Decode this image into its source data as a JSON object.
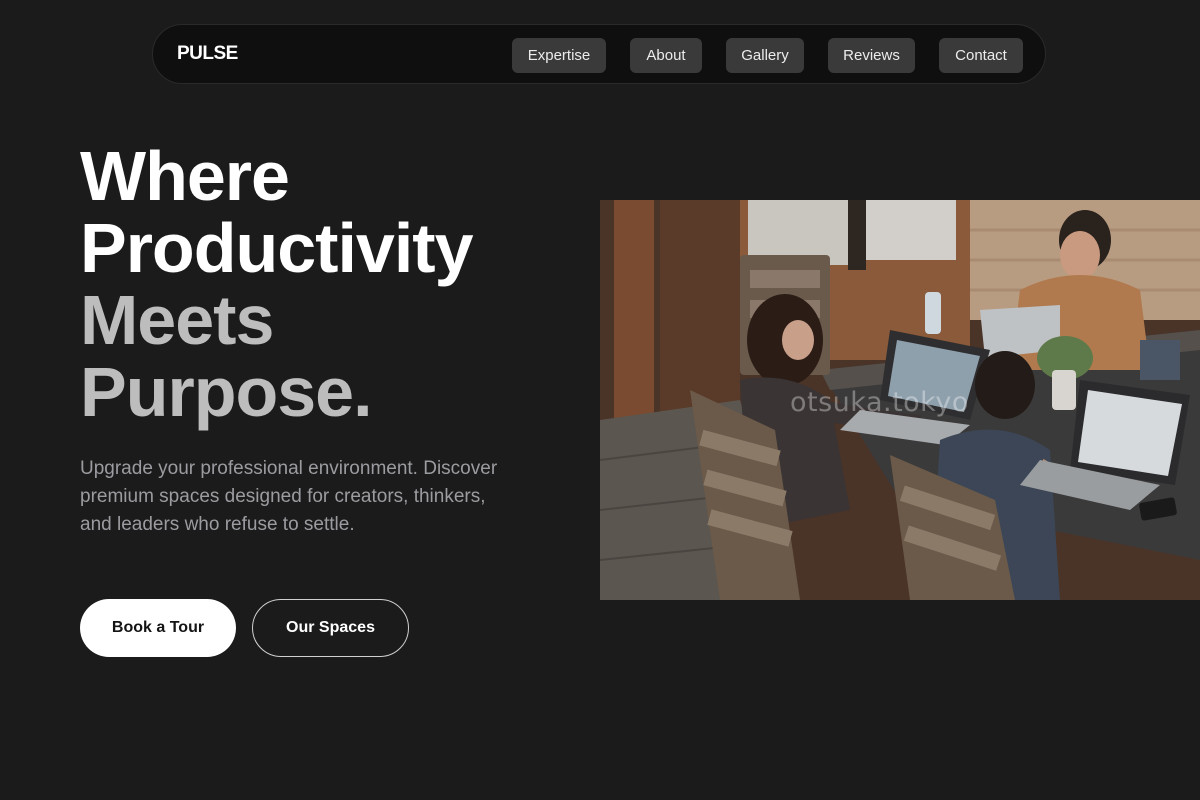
{
  "brand": "PULSE",
  "nav": {
    "items": [
      {
        "label": "Expertise"
      },
      {
        "label": "About"
      },
      {
        "label": "Gallery"
      },
      {
        "label": "Reviews"
      },
      {
        "label": "Contact"
      }
    ]
  },
  "hero": {
    "headline_lines": [
      "Where",
      "Productivity",
      "Meets",
      "Purpose."
    ],
    "subtitle": "Upgrade your professional environment. Discover premium spaces designed for creators, thinkers, and leaders who refuse to settle.",
    "primary_cta": "Book a Tour",
    "secondary_cta": "Our Spaces"
  },
  "photo": {
    "watermark": "otsuka.tokyo"
  },
  "colors": {
    "background": "#1b1b1c",
    "nav_background": "#0f0f10",
    "nav_button": "#3a3a3b",
    "headline_white": "#ffffff",
    "headline_grey": "#bdbdbd",
    "subtitle": "#9b9ca0"
  }
}
